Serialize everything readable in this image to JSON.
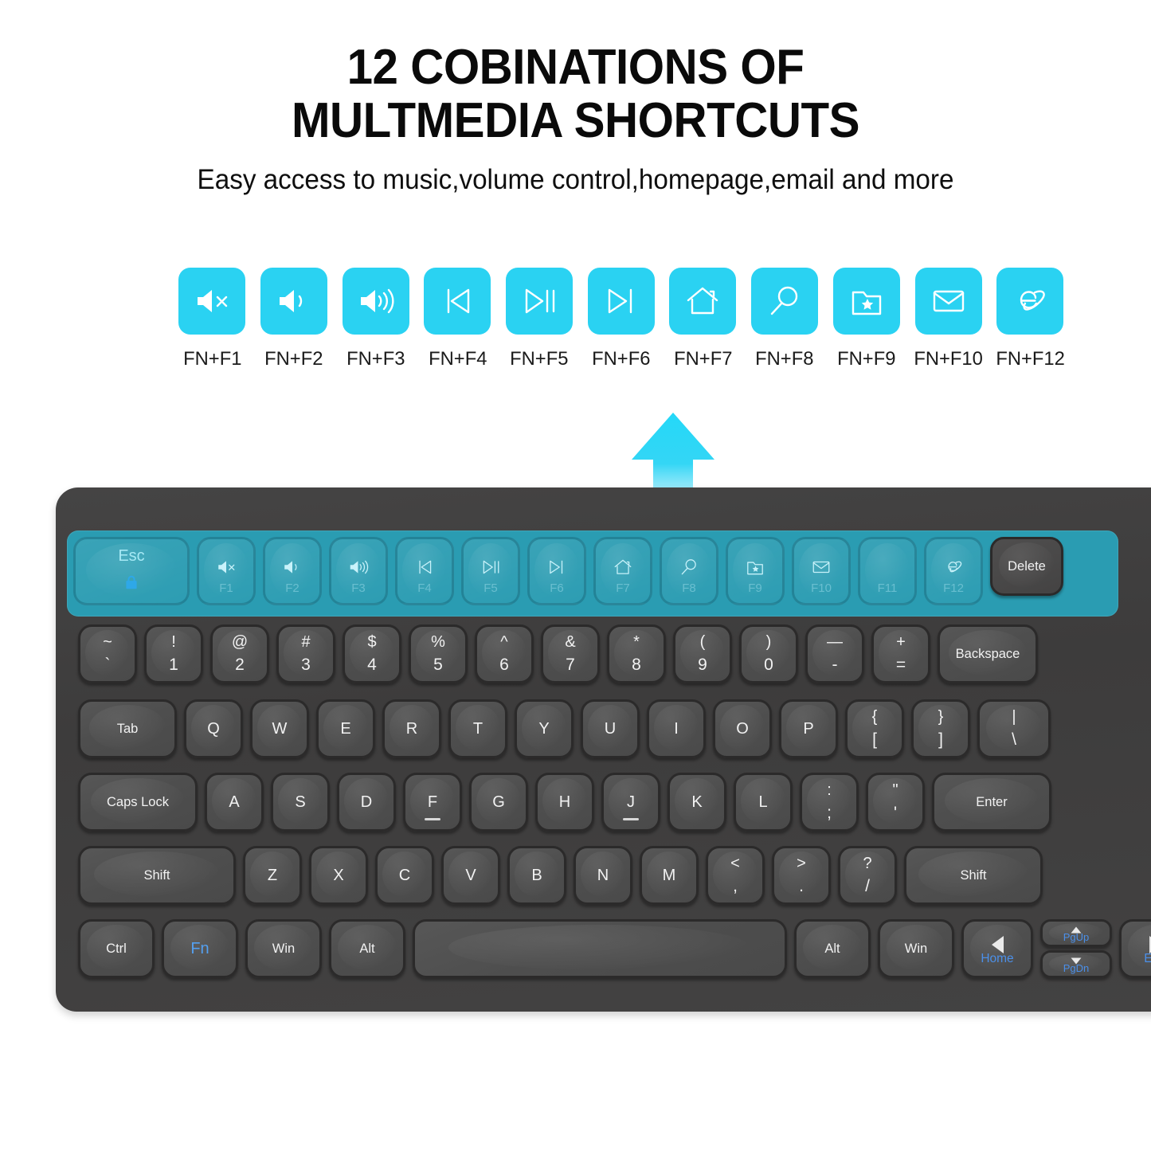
{
  "headline": {
    "line1": "12 COBINATIONS OF",
    "line2": "MULTMEDIA SHORTCUTS",
    "subtitle": "Easy access to music,volume control,homepage,email and more"
  },
  "theme": {
    "accent_cyan": "#2ad2f2",
    "band_teal": "#2a9cb2",
    "keyboard_body": "#414040",
    "key_face": "#4f4e4e",
    "key_text": "#f2f2f2",
    "fn_blue": "#4b8fe8",
    "fn_key_text": "#b9ecf5"
  },
  "shortcuts": [
    {
      "icon": "volume-mute-icon",
      "label": "FN+F1"
    },
    {
      "icon": "volume-down-icon",
      "label": "FN+F2"
    },
    {
      "icon": "volume-up-icon",
      "label": "FN+F3"
    },
    {
      "icon": "previous-track-icon",
      "label": "FN+F4"
    },
    {
      "icon": "play-pause-icon",
      "label": "FN+F5"
    },
    {
      "icon": "next-track-icon",
      "label": "FN+F6"
    },
    {
      "icon": "home-icon",
      "label": "FN+F7"
    },
    {
      "icon": "search-icon",
      "label": "FN+F8"
    },
    {
      "icon": "favorites-folder-icon",
      "label": "FN+F9"
    },
    {
      "icon": "email-icon",
      "label": "FN+F10"
    },
    {
      "icon": "browser-icon",
      "label": "FN+F12"
    }
  ],
  "arrow": {
    "name": "up-arrow-indicator",
    "direction": "up",
    "color": "#2ad2f2"
  },
  "keyboard": {
    "fn_row": [
      {
        "name": "esc-key",
        "label": "Esc",
        "icon": "lock-icon"
      },
      {
        "name": "f1-key",
        "fnum": "F1",
        "icon": "volume-mute-icon"
      },
      {
        "name": "f2-key",
        "fnum": "F2",
        "icon": "volume-down-icon"
      },
      {
        "name": "f3-key",
        "fnum": "F3",
        "icon": "volume-up-icon"
      },
      {
        "name": "f4-key",
        "fnum": "F4",
        "icon": "previous-track-icon"
      },
      {
        "name": "f5-key",
        "fnum": "F5",
        "icon": "play-pause-icon"
      },
      {
        "name": "f6-key",
        "fnum": "F6",
        "icon": "next-track-icon"
      },
      {
        "name": "f7-key",
        "fnum": "F7",
        "icon": "home-icon"
      },
      {
        "name": "f8-key",
        "fnum": "F8",
        "icon": "search-icon"
      },
      {
        "name": "f9-key",
        "fnum": "F9",
        "icon": "favorites-folder-icon"
      },
      {
        "name": "f10-key",
        "fnum": "F10",
        "icon": "email-icon"
      },
      {
        "name": "f11-key",
        "fnum": "F11",
        "icon": "none"
      },
      {
        "name": "f12-key",
        "fnum": "F12",
        "icon": "browser-icon"
      },
      {
        "name": "delete-key",
        "label": "Delete"
      }
    ],
    "number_row": [
      {
        "top": "~",
        "bot": "`"
      },
      {
        "top": "!",
        "bot": "1"
      },
      {
        "top": "@",
        "bot": "2"
      },
      {
        "top": "#",
        "bot": "3"
      },
      {
        "top": "$",
        "bot": "4"
      },
      {
        "top": "%",
        "bot": "5"
      },
      {
        "top": "^",
        "bot": "6"
      },
      {
        "top": "&",
        "bot": "7"
      },
      {
        "top": "*",
        "bot": "8"
      },
      {
        "top": "(",
        "bot": "9"
      },
      {
        "top": ")",
        "bot": "0"
      },
      {
        "top": "—",
        "bot": "-"
      },
      {
        "top": "+",
        "bot": "="
      },
      {
        "label": "Backspace"
      }
    ],
    "qwerty_row": [
      {
        "label": "Tab"
      },
      {
        "label": "Q"
      },
      {
        "label": "W"
      },
      {
        "label": "E"
      },
      {
        "label": "R"
      },
      {
        "label": "T"
      },
      {
        "label": "Y"
      },
      {
        "label": "U"
      },
      {
        "label": "I"
      },
      {
        "label": "O"
      },
      {
        "label": "P"
      },
      {
        "top": "{",
        "bot": "["
      },
      {
        "top": "}",
        "bot": "]"
      },
      {
        "top": "|",
        "bot": "\\"
      }
    ],
    "home_row": [
      {
        "label": "Caps Lock"
      },
      {
        "label": "A"
      },
      {
        "label": "S"
      },
      {
        "label": "D"
      },
      {
        "label": "F",
        "homing": true
      },
      {
        "label": "G"
      },
      {
        "label": "H"
      },
      {
        "label": "J",
        "homing": true
      },
      {
        "label": "K"
      },
      {
        "label": "L"
      },
      {
        "top": ":",
        "bot": ";"
      },
      {
        "top": "\"",
        "bot": "'"
      },
      {
        "label": "Enter"
      }
    ],
    "shift_row": [
      {
        "label": "Shift"
      },
      {
        "label": "Z"
      },
      {
        "label": "X"
      },
      {
        "label": "C"
      },
      {
        "label": "V"
      },
      {
        "label": "B"
      },
      {
        "label": "N"
      },
      {
        "label": "M"
      },
      {
        "top": "<",
        "bot": ","
      },
      {
        "top": ">",
        "bot": "."
      },
      {
        "top": "?",
        "bot": "/"
      },
      {
        "label": "Shift"
      }
    ],
    "bottom_row": {
      "ctrl": "Ctrl",
      "fn": "Fn",
      "win_left": "Win",
      "alt_left": "Alt",
      "space": "",
      "alt_right": "Alt",
      "win_right": "Win",
      "arrow_left": {
        "sub": "Home"
      },
      "arrow_up": {
        "sub": "PgUp"
      },
      "arrow_down": {
        "sub": "PgDn"
      },
      "arrow_right": {
        "sub": "End"
      }
    }
  }
}
